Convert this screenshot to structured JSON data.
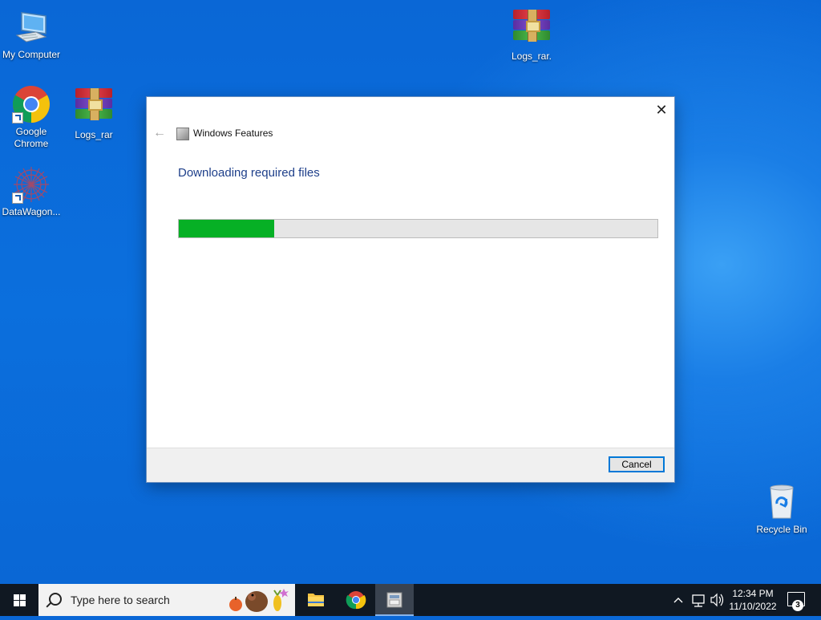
{
  "desktop": {
    "icons": [
      {
        "label": "My Computer"
      },
      {
        "label": "Google\nChrome"
      },
      {
        "label": "Logs_rar"
      },
      {
        "label": "DataWagon..."
      },
      {
        "label": "Logs_rar."
      },
      {
        "label": "Recycle Bin"
      }
    ]
  },
  "dialog": {
    "title": "Windows Features",
    "heading": "Downloading required files",
    "progress_fraction": 0.2,
    "cancel_label": "Cancel",
    "close_glyph": "✕",
    "back_glyph": "←"
  },
  "taskbar": {
    "search_placeholder": "Type here to search",
    "time": "12:34 PM",
    "date": "11/10/2022",
    "notification_count": "3",
    "accent": "#0078d7"
  },
  "colors": {
    "progress_fill": "#06b025",
    "heading": "#1e3f8a"
  }
}
